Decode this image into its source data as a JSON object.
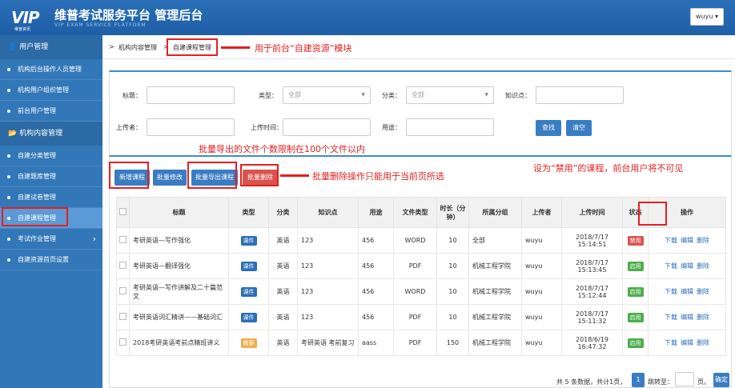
{
  "header": {
    "logo": "VIP",
    "logo_sub": "维普资讯",
    "brand": "维普考试服务平台 管理后台",
    "brand_sub": "VIP EXAM SERVICE PLATFORM",
    "user": "wuyu ▾"
  },
  "sidebar": {
    "groups": [
      {
        "label": "用户管理",
        "items": [
          "机构后台操作人员管理",
          "机构用户组织管理",
          "前台用户管理"
        ]
      },
      {
        "label": "机构内容管理",
        "items": [
          "自建分类管理",
          "自建题库管理",
          "自建试卷管理",
          "自建课程管理",
          "考试作业管理",
          "自建资源首页设置"
        ]
      }
    ]
  },
  "breadcrumb": {
    "sep": ">",
    "parent": "机构内容管理",
    "current": "自建课程管理"
  },
  "filters": {
    "title_label": "标题：",
    "type_label": "类型：",
    "type_value": "全部",
    "category_label": "分类：",
    "category_value": "全部",
    "knowledge_label": "知识点：",
    "uploader_label": "上传者：",
    "upload_time_label": "上传时间：",
    "usage_label": "用途：",
    "search_btn": "查找",
    "clear_btn": "清空"
  },
  "toolbar": {
    "add": "新增课程",
    "batch_edit": "批量修改",
    "batch_export": "批量导出课程",
    "batch_delete": "批量删除"
  },
  "table": {
    "headers": [
      "标题",
      "类型",
      "分类",
      "知识点",
      "用途",
      "文件类型",
      "时长（分钟）",
      "所属分组",
      "上传者",
      "上传时间",
      "状态",
      "操作"
    ],
    "rows": [
      {
        "title": "考研英语—写作强化",
        "type": "课件",
        "cat": "英语",
        "kp": "123",
        "use": "456",
        "ft": "WORD",
        "dur": "10",
        "group": "全部",
        "up": "wuyu",
        "time": "2018/7/17 15:14:51",
        "status": "禁用"
      },
      {
        "title": "考研英语—翻译强化",
        "type": "课件",
        "cat": "英语",
        "kp": "123",
        "use": "456",
        "ft": "PDF",
        "dur": "10",
        "group": "机械工程学院",
        "up": "wuyu",
        "time": "2018/7/17 15:13:45",
        "status": "启用"
      },
      {
        "title": "考研英语—写作讲解及二十篇范文",
        "type": "课件",
        "cat": "英语",
        "kp": "123",
        "use": "456",
        "ft": "WORD",
        "dur": "10",
        "group": "机械工程学院",
        "up": "wuyu",
        "time": "2018/7/17 15:12:44",
        "status": "启用"
      },
      {
        "title": "考研英语词汇精讲——基础词汇",
        "type": "课件",
        "cat": "英语",
        "kp": "123",
        "use": "456",
        "ft": "PDF",
        "dur": "10",
        "group": "机械工程学院",
        "up": "wuyu",
        "time": "2018/7/17 15:11:32",
        "status": "启用"
      },
      {
        "title": "2018考研英语考前点睛班讲义",
        "type": "教案",
        "cat": "英语",
        "kp": "考研英语 考前复习",
        "use": "aass",
        "ft": "PDF",
        "dur": "150",
        "group": "机械工程学院",
        "up": "wuyu",
        "time": "2018/6/19 16:47:32",
        "status": "启用"
      }
    ],
    "ops": [
      "下载",
      "编辑",
      "删除"
    ]
  },
  "pager": {
    "summary": "共 5 条数据，共计1页，",
    "page": "1",
    "goto": "跳转至：",
    "unit": "页。",
    "confirm": "确定"
  },
  "annotations": {
    "a1": "用于前台“自建资源”模块",
    "a2": "批量导出的文件个数限制在100个文件以内",
    "a3": "批量删除操作只能用于当前页所选",
    "a4": "设为“禁用”的课程，前台用户将不可见"
  },
  "colors": {
    "header": "#1e5ea6",
    "sidebar": "#3277b8",
    "annotation": "#e4201f",
    "enabled": "#4cae4c",
    "disabled": "#d9534f",
    "courseware": "#2a6fb8",
    "lesson_plan": "#f0ad4e"
  }
}
